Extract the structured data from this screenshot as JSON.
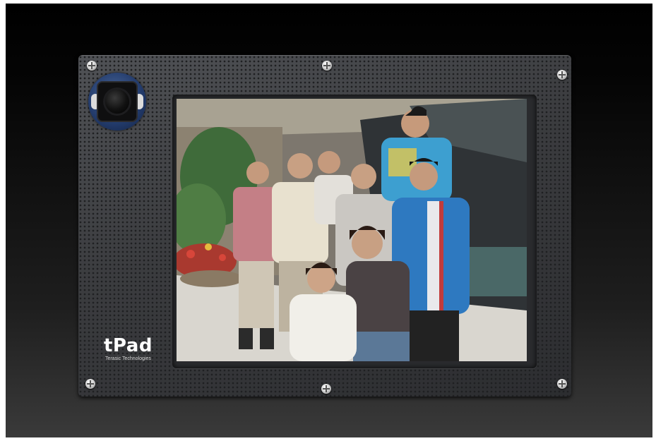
{
  "device": {
    "brand_name": "tPad",
    "brand_subtitle": "Terasic Technologies"
  },
  "screen": {
    "content": "group-photo"
  },
  "colors": {
    "panel": "#3b3c3f",
    "background_top": "#000000",
    "background_bottom": "#3a3a3a",
    "camera_ring": "#223a6a"
  }
}
